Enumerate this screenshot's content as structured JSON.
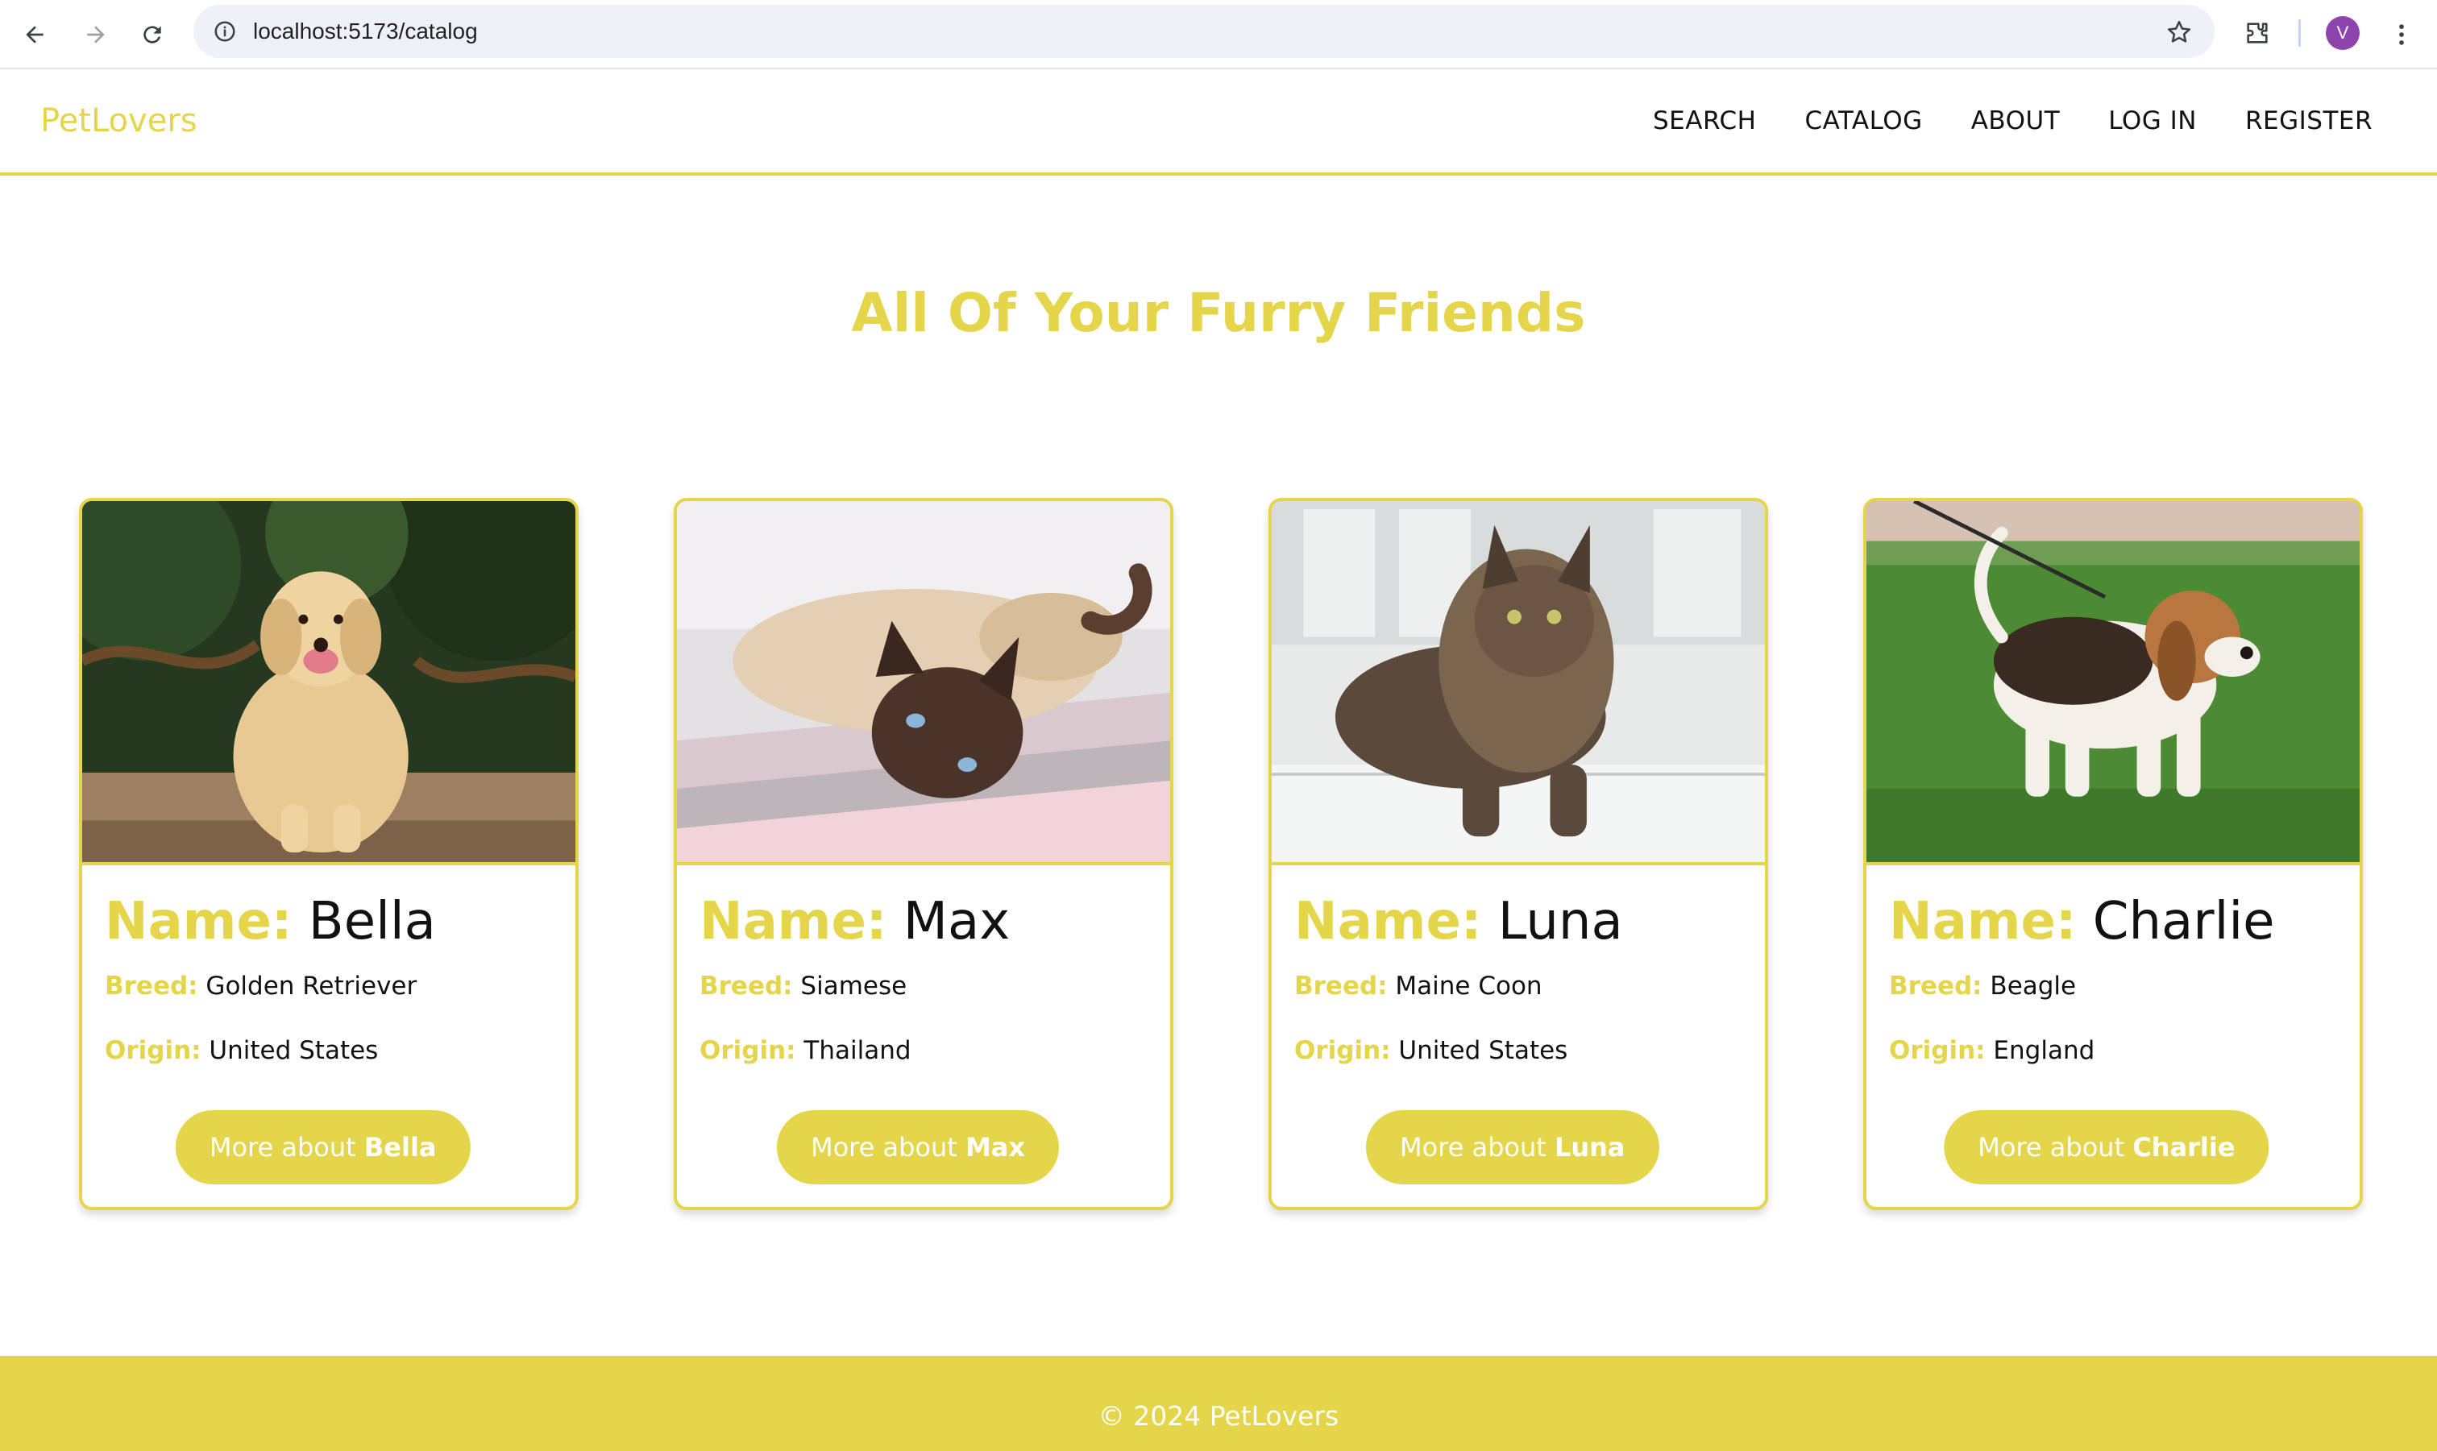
{
  "browser": {
    "url": "localhost:5173/catalog",
    "profile_initial": "V",
    "icons": [
      "back-arrow-icon",
      "forward-arrow-icon",
      "reload-icon",
      "site-info-icon",
      "bookmark-star-icon",
      "extensions-puzzle-icon",
      "kebab-menu-icon"
    ]
  },
  "header": {
    "logo": "PetLovers",
    "nav": [
      {
        "label": "SEARCH"
      },
      {
        "label": "CATALOG"
      },
      {
        "label": "ABOUT"
      },
      {
        "label": "LOG IN"
      },
      {
        "label": "REGISTER"
      }
    ]
  },
  "main": {
    "title": "All Of Your Furry Friends",
    "labels": {
      "name": "Name:",
      "breed": "Breed:",
      "origin": "Origin:",
      "more": "More about"
    },
    "pets": [
      {
        "name": "Bella",
        "breed": "Golden Retriever",
        "origin": "United States",
        "image": "golden-retriever-photo"
      },
      {
        "name": "Max",
        "breed": "Siamese",
        "origin": "Thailand",
        "image": "siamese-cat-photo"
      },
      {
        "name": "Luna",
        "breed": "Maine Coon",
        "origin": "United States",
        "image": "maine-coon-photo"
      },
      {
        "name": "Charlie",
        "breed": "Beagle",
        "origin": "England",
        "image": "beagle-photo"
      }
    ]
  },
  "footer": {
    "text": "© 2024 PetLovers"
  },
  "colors": {
    "accent": "#e4d54a",
    "text": "#111111",
    "avatar": "#8e44ad"
  }
}
